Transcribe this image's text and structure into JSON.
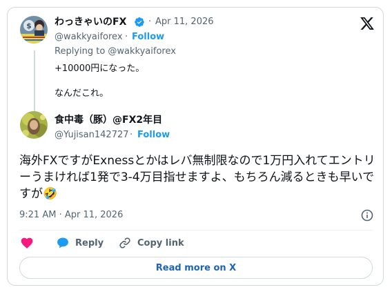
{
  "reply_to": {
    "author_name": "わっきゃいのFX",
    "separator": "·",
    "date": "Apr 11, 2026",
    "handle": "@wakkyaiforex",
    "separator2": "·",
    "follow_label": "Follow",
    "replying_to": "Replying to @wakkyaiforex",
    "text_line1": "+10000円になった。",
    "text_line2": "なんだこれ。"
  },
  "tweet": {
    "author_name": "食中毒（豚）@FX2年目",
    "handle": "@Yujisan142727",
    "separator": "·",
    "follow_label": "Follow",
    "text": "海外FXですがExnessとかはレバ無制限なので1万円入れてエントリーうまければ1発で3-4万目指せますよ、もちろん減るときも早いですが🤣",
    "timestamp": "9:21 AM · Apr 11, 2026"
  },
  "actions": {
    "reply_label": "Reply",
    "copy_link_label": "Copy link"
  },
  "read_more_label": "Read more on X",
  "colors": {
    "accent": "#1d9bf0",
    "like": "#f91880",
    "verified": "#1d9bf0",
    "read_more": "#1d63b8"
  }
}
